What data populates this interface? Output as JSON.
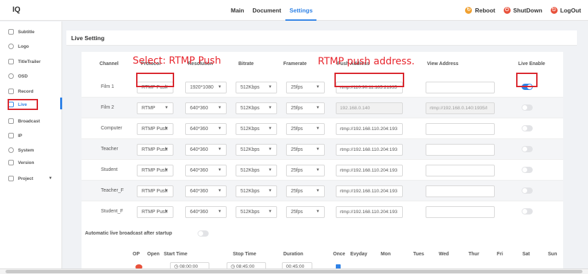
{
  "app": {
    "logo_text": "IQ"
  },
  "nav": {
    "items": [
      "Main",
      "Document",
      "Settings"
    ],
    "active": "Settings"
  },
  "top_buttons": [
    {
      "label": "Reboot",
      "color": "#f0a030"
    },
    {
      "label": "ShutDown",
      "color": "#e8513b"
    },
    {
      "label": "LogOut",
      "color": "#e8513b"
    }
  ],
  "sidebar": {
    "items": [
      "Subtitle",
      "Logo",
      "TitleTrailer",
      "OSD",
      "Record",
      "Live",
      "Broadcast",
      "IP",
      "System",
      "Version",
      "Project"
    ],
    "active": "Live"
  },
  "section_title": "Live Setting",
  "table": {
    "headers": [
      "Channel",
      "Protocol",
      "Resolution",
      "Bitrate",
      "Framerate",
      "Push Address",
      "View Address",
      "Live Enable"
    ],
    "rows": [
      {
        "channel": "Film 1",
        "protocol": "RTMP Push",
        "resolution": "1920*1080",
        "bitrate": "512Kbps",
        "framerate": "25fps",
        "push": "rtmp://110.90.11.185:21935",
        "view": "",
        "enabled": true
      },
      {
        "channel": "Film 2",
        "protocol": "RTMP",
        "resolution": "640*360",
        "bitrate": "512Kbps",
        "framerate": "25fps",
        "push": "192.168.0.140",
        "view": "rtmp://192.168.0.140:1935/l",
        "enabled": false
      },
      {
        "channel": "Computer",
        "protocol": "RTMP Push",
        "resolution": "640*360",
        "bitrate": "512Kbps",
        "framerate": "25fps",
        "push": "rtmp://192.168.110.204:193",
        "view": "",
        "enabled": false
      },
      {
        "channel": "Teacher",
        "protocol": "RTMP Push",
        "resolution": "640*360",
        "bitrate": "512Kbps",
        "framerate": "25fps",
        "push": "rtmp://192.168.110.204:193",
        "view": "",
        "enabled": false
      },
      {
        "channel": "Student",
        "protocol": "RTMP Push",
        "resolution": "640*360",
        "bitrate": "512Kbps",
        "framerate": "25fps",
        "push": "rtmp://192.168.110.204:193",
        "view": "",
        "enabled": false
      },
      {
        "channel": "Teacher_F",
        "protocol": "RTMP Push",
        "resolution": "640*360",
        "bitrate": "512Kbps",
        "framerate": "25fps",
        "push": "rtmp://192.168.110.204:193",
        "view": "",
        "enabled": false
      },
      {
        "channel": "Student_F",
        "protocol": "RTMP Push",
        "resolution": "640*360",
        "bitrate": "512Kbps",
        "framerate": "25fps",
        "push": "rtmp://192.168.110.204:193",
        "view": "",
        "enabled": false
      }
    ]
  },
  "annotations": {
    "select_text": "Select: RTMP Push",
    "address_text": "RTMP push address."
  },
  "auto": {
    "title": "Automatic live broadcast after startup",
    "headers": [
      "OP",
      "Open",
      "Start Time",
      "Stop Time",
      "Duration",
      "Once",
      "Evyday",
      "Mon",
      "Tues",
      "Wed",
      "Thur",
      "Fri",
      "Sat",
      "Sun"
    ],
    "start_time": "08:00:00",
    "stop_time": "08:45:00",
    "duration": "00:45:00"
  }
}
